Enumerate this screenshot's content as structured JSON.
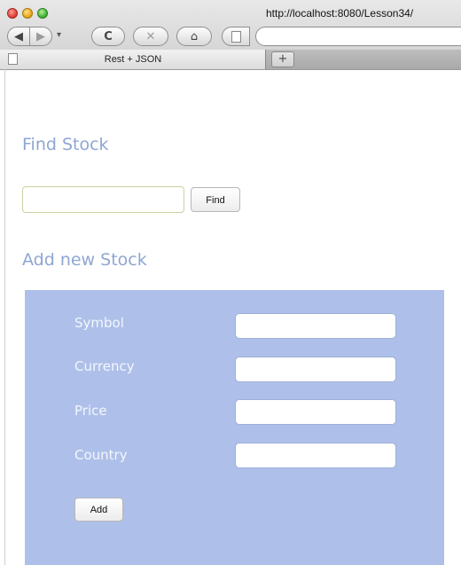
{
  "browser": {
    "url": "http://localhost:8080/Lesson34/",
    "tab_title": "Rest + JSON",
    "new_tab_label": "+"
  },
  "page": {
    "find_heading": "Find Stock",
    "find_button": "Find",
    "add_heading": "Add new Stock",
    "form": {
      "fields": [
        {
          "label": "Symbol"
        },
        {
          "label": "Currency"
        },
        {
          "label": "Price"
        },
        {
          "label": "Country"
        }
      ],
      "add_button": "Add"
    }
  },
  "colors": {
    "heading": "#8fa6d2",
    "form_background": "#aec0e9"
  },
  "icons": {
    "back": "back-arrow-icon",
    "forward": "forward-arrow-icon",
    "reload": "reload-icon",
    "stop": "stop-icon",
    "home": "home-icon",
    "page": "page-icon"
  }
}
